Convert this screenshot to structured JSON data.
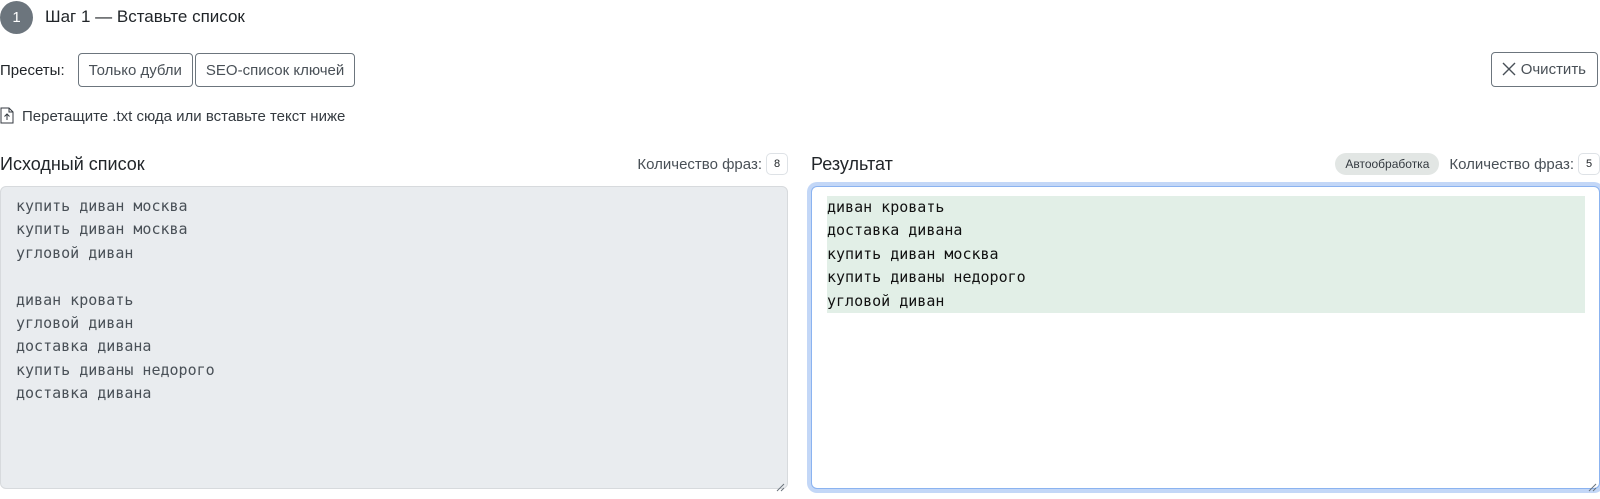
{
  "step": {
    "number": "1",
    "title": "Шаг 1 — Вставьте список"
  },
  "presets": {
    "label": "Пресеты:",
    "items": [
      "Только дубли",
      "SEO-список ключей"
    ]
  },
  "clear_button": {
    "label": "Очистить",
    "icon": "close-icon"
  },
  "drop_hint": {
    "text": "Перетащите .txt сюда или вставьте текст ниже",
    "icon": "file-upload-icon"
  },
  "source": {
    "title": "Исходный список",
    "count_label": "Количество фраз:",
    "count": "8",
    "lines": [
      "купить диван москва",
      "купить диван москва",
      "угловой диван",
      "",
      "диван кровать",
      "угловой диван",
      "доставка дивана",
      "купить диваны недорого",
      "доставка дивана"
    ]
  },
  "result": {
    "title": "Результат",
    "auto_badge": "Автообработка",
    "count_label": "Количество фраз:",
    "count": "5",
    "lines": [
      "диван кровать",
      "доставка дивана",
      "купить диван москва",
      "купить диваны недорого",
      "угловой диван"
    ]
  },
  "colors": {
    "step_circle": "#6c757d",
    "result_focus_ring": "#c3d7f7",
    "result_line_highlight": "#e2efe7",
    "source_bg": "#e9ecef"
  }
}
